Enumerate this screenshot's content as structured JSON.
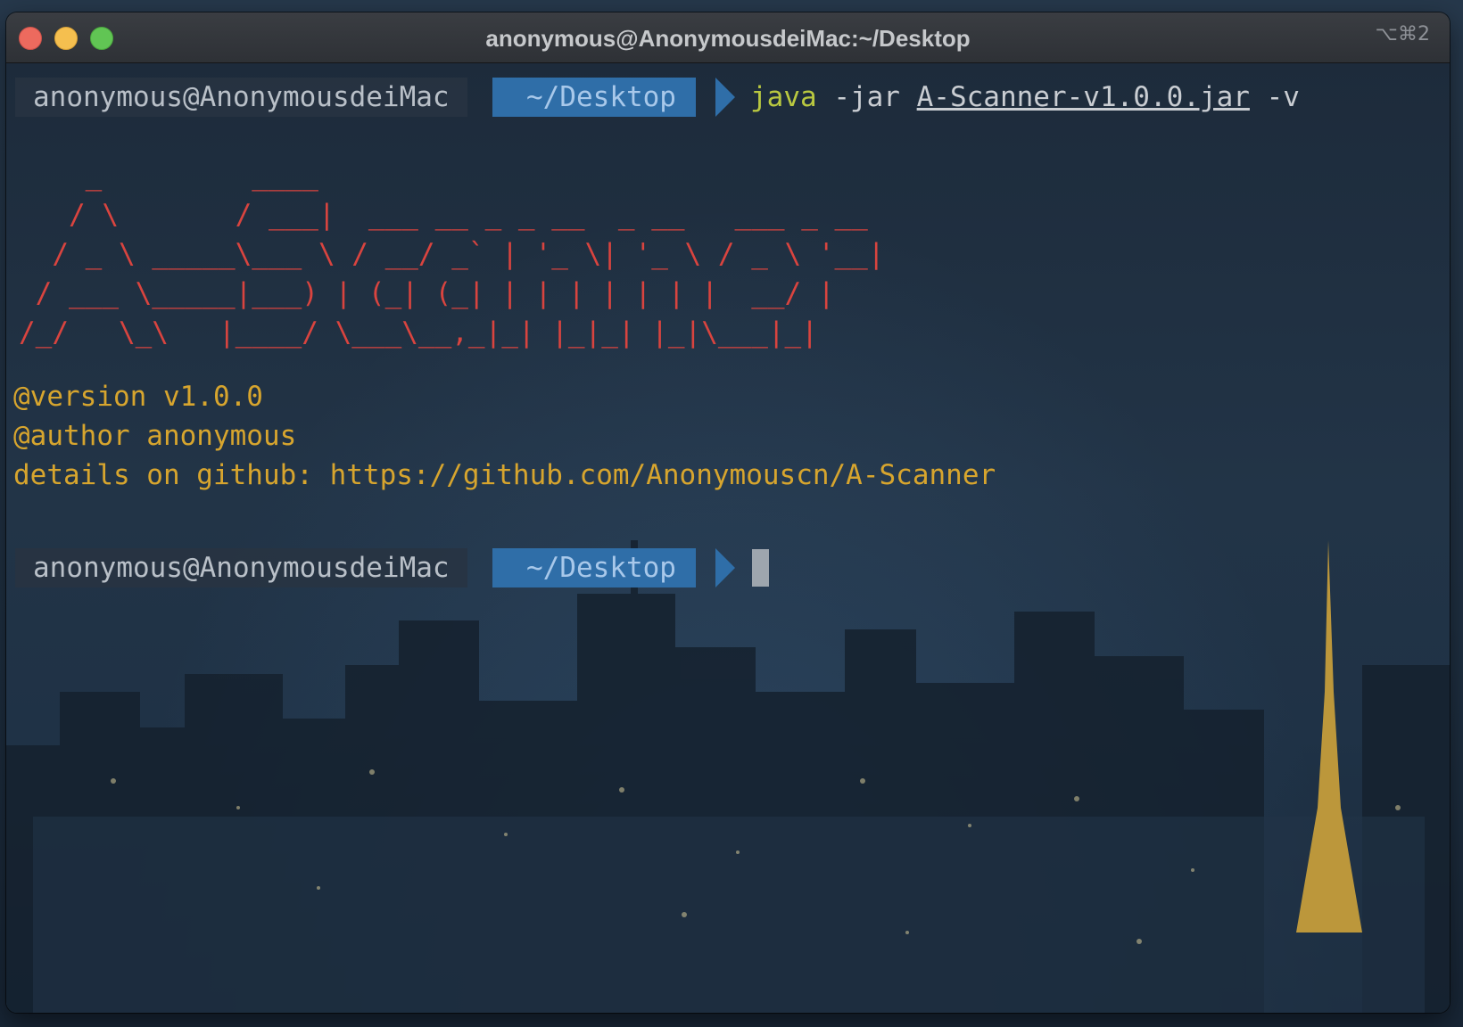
{
  "window": {
    "title": "anonymous@AnonymousdeiMac:~/Desktop",
    "shortcut": "⌥⌘2"
  },
  "prompt1": {
    "user": "anonymous@AnonymousdeiMac",
    "dir": "~/Desktop",
    "command_bin": "java",
    "command_flag": " -jar ",
    "command_file": "A-Scanner-v1.0.0.jar",
    "command_arg": " -v"
  },
  "banner": {
    "ascii_lines": [
      "    _         ____",
      "   / \\       / ___|  ___ __ _ _ __  _ __   ___ _ __",
      "  / _ \\ _____\\___ \\ / __/ _` | '_ \\| '_ \\ / _ \\ '__|",
      " / ___ \\_____|___) | (_| (_| | | | | | | |  __/ |",
      "/_/   \\_\\   |____/ \\___\\__,_|_| |_|_| |_|\\___|_|"
    ],
    "version_line": "@version v1.0.0",
    "author_line": "@author anonymous",
    "details_line": "details on github: https://github.com/Anonymouscn/A-Scanner"
  },
  "prompt2": {
    "user": "anonymous@AnonymousdeiMac",
    "dir": "~/Desktop"
  },
  "colors": {
    "ascii_red": "#d9443f",
    "info_yellow": "#d7a52e",
    "dir_blue": "#2f6ea8",
    "command_green": "#b9c840"
  }
}
